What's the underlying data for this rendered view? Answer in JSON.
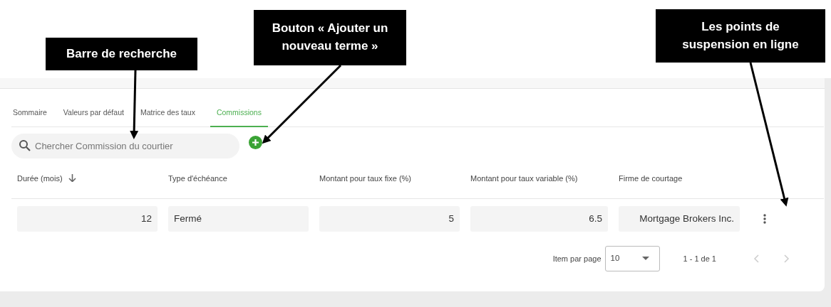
{
  "tabs": [
    {
      "label": "Sommaire",
      "selected": false
    },
    {
      "label": "Valeurs par défaut",
      "selected": false
    },
    {
      "label": "Matrice des taux",
      "selected": false
    },
    {
      "label": "Commissions",
      "selected": true
    }
  ],
  "search": {
    "placeholder": "Chercher Commission du courtier"
  },
  "table": {
    "columns": [
      {
        "label": "Durée (mois)",
        "sorted": true
      },
      {
        "label": "Type d'échéance",
        "sorted": false
      },
      {
        "label": "Montant pour taux fixe (%)",
        "sorted": false
      },
      {
        "label": "Montant pour taux variable (%)",
        "sorted": false
      },
      {
        "label": "Firme de courtage",
        "sorted": false
      }
    ],
    "rows": [
      {
        "cells": [
          "12",
          "Fermé",
          "5",
          "6.5",
          "Mortgage Brokers Inc."
        ]
      }
    ]
  },
  "pagination": {
    "label": "Item par page",
    "page_size": "10",
    "range": "1 - 1 de 1"
  },
  "annotations": [
    {
      "text": "Barre de recherche"
    },
    {
      "text": "Bouton « Ajouter un nouveau terme »"
    },
    {
      "text": "Les points de suspension en ligne"
    }
  ]
}
